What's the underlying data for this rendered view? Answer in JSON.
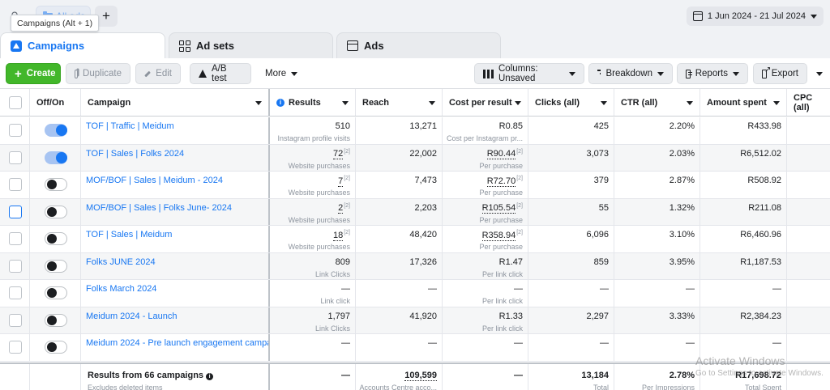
{
  "topbar": {
    "tooltip": "Campaigns (Alt + 1)",
    "all_ads": "All ads",
    "plus": "+",
    "date_range": "1 Jun 2024 - 21 Jul 2024"
  },
  "tabs": [
    {
      "label": "Campaigns"
    },
    {
      "label": "Ad sets"
    },
    {
      "label": "Ads"
    }
  ],
  "toolbar": {
    "create": "Create",
    "duplicate": "Duplicate",
    "edit": "Edit",
    "ab_test": "A/B test",
    "more": "More",
    "columns": "Columns: Unsaved",
    "breakdown": "Breakdown",
    "reports": "Reports",
    "export": "Export"
  },
  "columns": [
    "Off/On",
    "Campaign",
    "Results",
    "Reach",
    "Cost per result",
    "Clicks (all)",
    "CTR (all)",
    "Amount spent",
    "CPC (all)"
  ],
  "rows": [
    {
      "on": true,
      "campaign": "TOF | Traffic | Meidum",
      "results": "510",
      "results_sub": "Instagram profile visits",
      "reach": "13,271",
      "cost": "R0.85",
      "cost_sub": "Cost per Instagram pr...",
      "clicks": "425",
      "ctr": "2.20%",
      "spent": "R433.98"
    },
    {
      "on": true,
      "campaign": "TOF | Sales | Folks 2024",
      "results": "72",
      "results_sub": "Website purchases",
      "reach": "22,002",
      "cost": "R90.44",
      "cost_sub": "Per purchase",
      "clicks": "3,073",
      "ctr": "2.03%",
      "spent": "R6,512.02"
    },
    {
      "on": false,
      "campaign": "MOF/BOF | Sales | Meidum - 2024",
      "results": "7",
      "results_sub": "Website purchases",
      "reach": "7,473",
      "cost": "R72.70",
      "cost_sub": "Per purchase",
      "clicks": "379",
      "ctr": "2.87%",
      "spent": "R508.92"
    },
    {
      "on": false,
      "campaign": "MOF/BOF | Sales | Folks June- 2024",
      "results": "2",
      "results_sub": "Website purchases",
      "reach": "2,203",
      "cost": "R105.54",
      "cost_sub": "Per purchase",
      "clicks": "55",
      "ctr": "1.32%",
      "spent": "R211.08"
    },
    {
      "on": false,
      "campaign": "TOF | Sales | Meidum",
      "results": "18",
      "results_sub": "Website purchases",
      "reach": "48,420",
      "cost": "R358.94",
      "cost_sub": "Per purchase",
      "clicks": "6,096",
      "ctr": "3.10%",
      "spent": "R6,460.96"
    },
    {
      "on": false,
      "campaign": "Folks JUNE 2024",
      "results": "809",
      "results_sub": "Link Clicks",
      "reach": "17,326",
      "cost": "R1.47",
      "cost_sub": "Per link click",
      "clicks": "859",
      "ctr": "3.95%",
      "spent": "R1,187.53"
    },
    {
      "on": false,
      "campaign": "Folks March 2024",
      "results": "—",
      "results_sub": "Link click",
      "reach": "—",
      "cost": "—",
      "cost_sub": "Per link click",
      "clicks": "—",
      "ctr": "—",
      "spent": "—"
    },
    {
      "on": false,
      "campaign": "Meidum 2024 - Launch",
      "results": "1,797",
      "results_sub": "Link Clicks",
      "reach": "41,920",
      "cost": "R1.33",
      "cost_sub": "Per link click",
      "clicks": "2,297",
      "ctr": "3.33%",
      "spent": "R2,384.23"
    },
    {
      "on": false,
      "campaign": "Meidum 2024 - Pre launch engagement campa...",
      "results": "—",
      "results_sub": "",
      "reach": "—",
      "cost": "—",
      "cost_sub": "",
      "clicks": "—",
      "ctr": "—",
      "spent": "—"
    }
  ],
  "footnote": "[2]",
  "summary": {
    "title": "Results from 66 campaigns",
    "subtitle": "Excludes deleted items",
    "results": "—",
    "reach": "109,599",
    "reach_sub": "Accounts Centre acco...",
    "cost": "—",
    "clicks": "13,184",
    "clicks_sub": "Total",
    "ctr": "2.78%",
    "ctr_sub": "Per Impressions",
    "spent": "R17,698.72",
    "spent_sub": "Total Spent"
  },
  "watermark": {
    "line1": "Activate Windows",
    "line2": "Go to Settings to activate Windows."
  },
  "colors": {
    "accent": "#1877f2",
    "create": "#42b72a"
  }
}
